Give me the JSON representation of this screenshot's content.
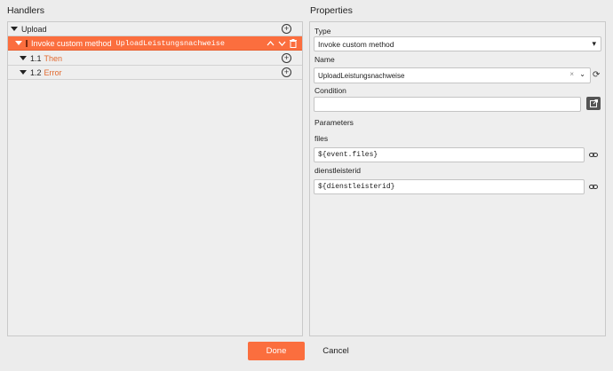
{
  "handlers": {
    "title": "Handlers",
    "tree": {
      "upload_label": "Upload",
      "invoke_label": "Invoke custom method",
      "invoke_method": "UploadLeistungsnachweise",
      "then_index": "1.1",
      "then_label": "Then",
      "error_index": "1.2",
      "error_label": "Error"
    }
  },
  "properties": {
    "title": "Properties",
    "type_label": "Type",
    "type_value": "Invoke custom method",
    "name_label": "Name",
    "name_value": "UploadLeistungsnachweise",
    "condition_label": "Condition",
    "condition_value": "",
    "parameters_label": "Parameters",
    "params": [
      {
        "label": "files",
        "value": "${event.files}"
      },
      {
        "label": "dienstleisterid",
        "value": "${dienstleisterid}"
      }
    ]
  },
  "footer": {
    "done_label": "Done",
    "cancel_label": "Cancel"
  },
  "colors": {
    "accent": "#fb6e3e",
    "background": "#ececec"
  },
  "icons": {
    "add": "plus-circle-icon",
    "move_up": "chevron-up-icon",
    "move_down": "chevron-down-icon",
    "delete": "trash-icon",
    "refresh": "refresh-icon",
    "external": "external-link-icon",
    "link": "link-icon"
  }
}
